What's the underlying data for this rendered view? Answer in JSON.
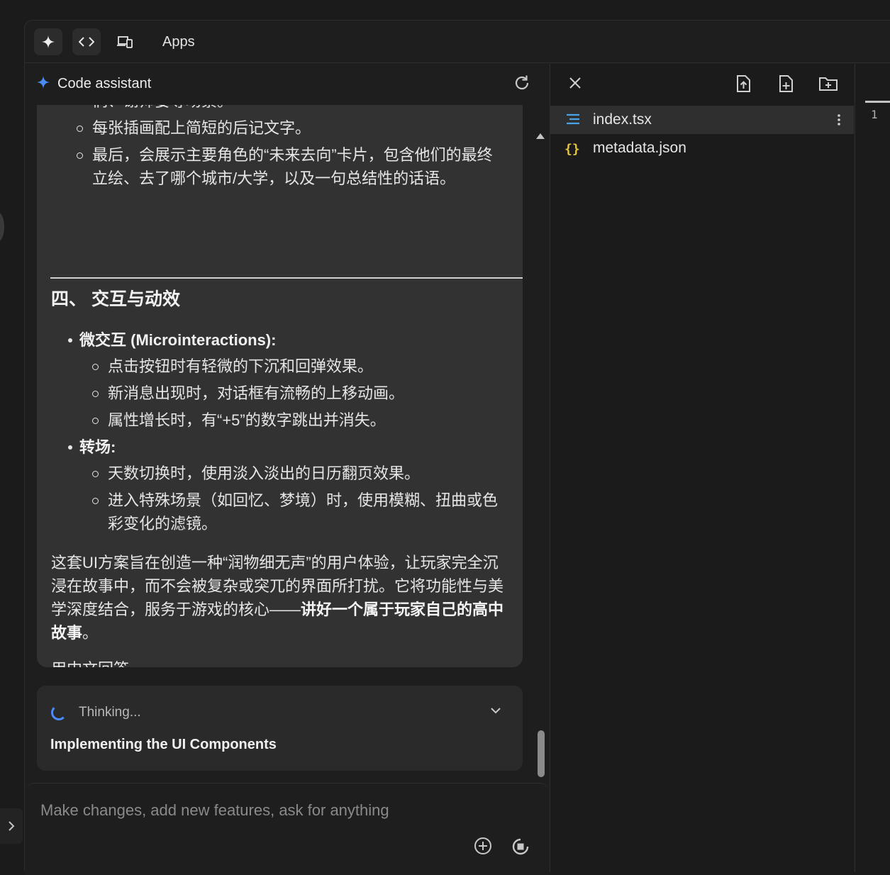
{
  "topbar": {
    "apps_label": "Apps"
  },
  "chat": {
    "title": "Code assistant",
    "message": {
      "cut_line": "们、谢师宴等场景。",
      "list_a": [
        "每张插画配上简短的后记文字。",
        "最后，会展示主要角色的“未来去向”卡片，包含他们的最终立绘、去了哪个城市/大学，以及一句总结性的话语。"
      ],
      "section_heading": "四、 交互与动效",
      "bullets": [
        {
          "title": "微交互 (Microinteractions):",
          "items": [
            "点击按钮时有轻微的下沉和回弹效果。",
            "新消息出现时，对话框有流畅的上移动画。",
            "属性增长时，有“+5”的数字跳出并消失。"
          ]
        },
        {
          "title": "转场:",
          "items": [
            "天数切换时，使用淡入淡出的日历翻页效果。",
            "进入特殊场景（如回忆、梦境）时，使用模糊、扭曲或色彩变化的滤镜。"
          ]
        }
      ],
      "summary_prefix": "这套UI方案旨在创造一种“润物细无声”的用户体验，让玩家完全沉浸在故事中，而不会被复杂或突兀的界面所打扰。它将功能性与美学深度结合，服务于游戏的核心——",
      "summary_bold": "讲好一个属于玩家自己的高中故事",
      "summary_suffix": "。",
      "footer_note": "用中文回答"
    },
    "thinking": {
      "label": "Thinking...",
      "detail": "Implementing the UI Components"
    },
    "input": {
      "placeholder": "Make changes, add new features, ask for anything"
    }
  },
  "files": {
    "items": [
      {
        "name": "index.tsx",
        "icon": "typescript-file-icon",
        "active": true
      },
      {
        "name": "metadata.json",
        "icon": "json-file-icon",
        "active": false
      }
    ]
  },
  "editor": {
    "line_number": "1"
  },
  "colors": {
    "accent": "#4a8cff",
    "json_icon": "#e2c541",
    "ts_icon": "#4aa3e8"
  }
}
